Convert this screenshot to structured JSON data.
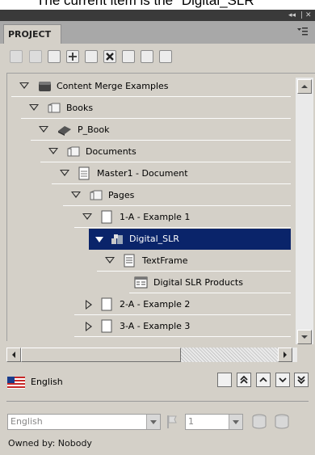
{
  "caption": "The current item is the \"Digital_SLR\"",
  "panel": {
    "tab_label": "PROJECT",
    "header_controls": [
      "◂◂",
      "|",
      "✕"
    ]
  },
  "tree": {
    "rows": [
      {
        "label": "Content Merge Examples",
        "icon": "book-dark-icon",
        "expander": "expanded"
      },
      {
        "label": "Books",
        "icon": "folder-icon",
        "expander": "expanded"
      },
      {
        "label": "P_Book",
        "icon": "book-icon",
        "expander": "expanded"
      },
      {
        "label": "Documents",
        "icon": "folder-icon",
        "expander": "expanded"
      },
      {
        "label": "Master1 - Document",
        "icon": "document-icon",
        "expander": "expanded"
      },
      {
        "label": "Pages",
        "icon": "folder-icon",
        "expander": "expanded"
      },
      {
        "label": "1-A - Example 1",
        "icon": "page-icon",
        "expander": "expanded"
      },
      {
        "label": "Digital_SLR",
        "icon": "content-item-icon",
        "expander": "expanded",
        "selected": true
      },
      {
        "label": "TextFrame",
        "icon": "text-frame-icon",
        "expander": "expanded"
      },
      {
        "label": "Digital SLR Products",
        "icon": "table-icon",
        "expander": "none"
      },
      {
        "label": "2-A - Example 2",
        "icon": "page-icon",
        "expander": "collapsed"
      },
      {
        "label": "3-A - Example 3",
        "icon": "page-icon",
        "expander": "collapsed"
      }
    ]
  },
  "language": {
    "label": "English",
    "flag": "us-flag-icon"
  },
  "bottom": {
    "language_select": "English",
    "number_select": "1",
    "owner_text": "Owned by: Nobody"
  },
  "colors": {
    "selection": "#0a246a",
    "panel": "#d4d0c8",
    "header": "#3a3a3a"
  }
}
